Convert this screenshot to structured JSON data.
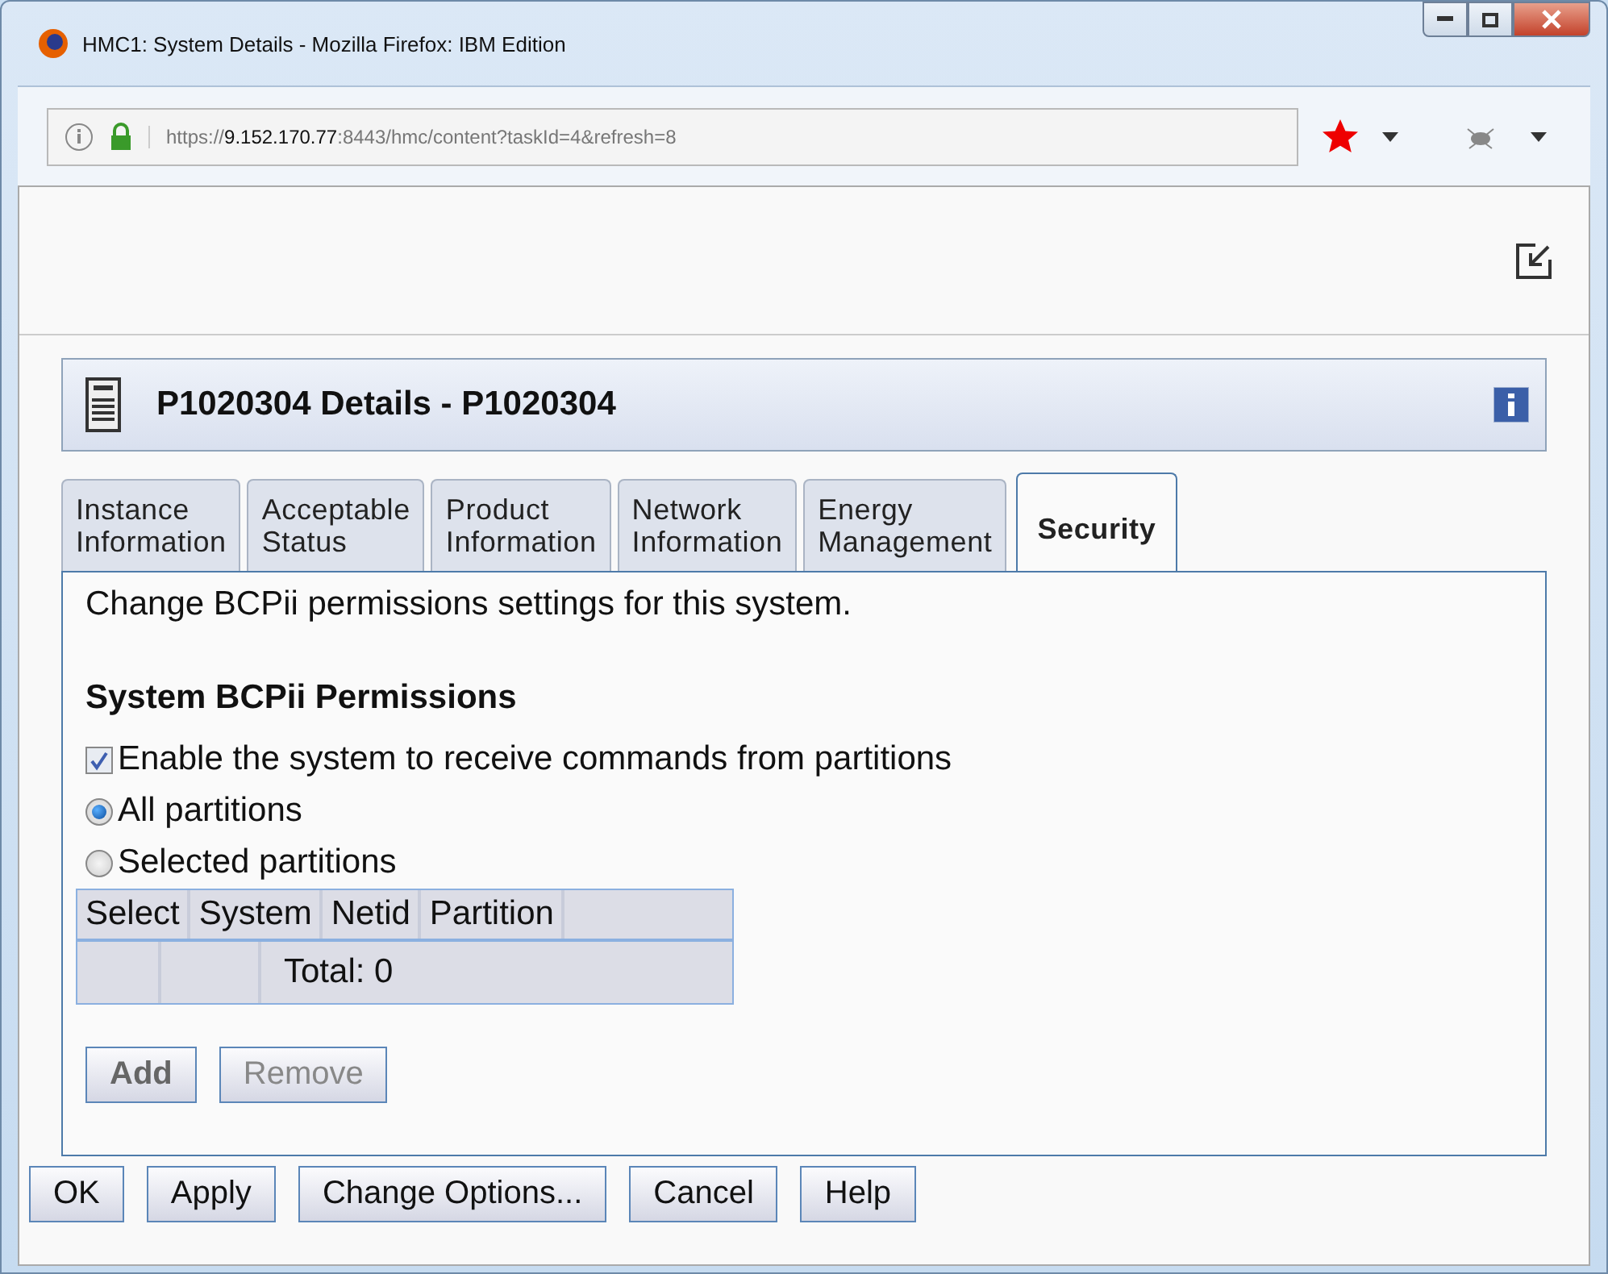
{
  "window": {
    "title": "HMC1: System Details - Mozilla Firefox: IBM Edition"
  },
  "address_bar": {
    "url": "https://**9.152.170.77**:8443/hmc/content?taskId=4&refresh=8"
  },
  "panel": {
    "title": "P1020304 Details - P1020304"
  },
  "tabs": [
    {
      "label": "Instance Information",
      "selected": false
    },
    {
      "label": "Acceptable Status",
      "selected": false
    },
    {
      "label": "Product Information",
      "selected": false
    },
    {
      "label": "Network Information",
      "selected": false
    },
    {
      "label": "Energy Management",
      "selected": false
    },
    {
      "label": "Security",
      "selected": true
    }
  ],
  "description": "Change BCPii permissions settings for this system.",
  "section_title": "System BCPii Permissions",
  "enable_checkbox": {
    "label": "Enable the system to receive commands from partitions",
    "checked": true
  },
  "radios": [
    {
      "label": "All partitions",
      "selected": true
    },
    {
      "label": "Selected partitions",
      "selected": false
    }
  ],
  "table": {
    "columns": [
      "Select",
      "System",
      "Netid",
      "Partition"
    ],
    "total": "Total: 0"
  },
  "table_buttons": [
    {
      "label": "Add",
      "disabled": false
    },
    {
      "label": "Remove",
      "disabled": true
    }
  ],
  "buttons": [
    "OK",
    "Apply",
    "Change Options...",
    "Cancel",
    "Help"
  ]
}
